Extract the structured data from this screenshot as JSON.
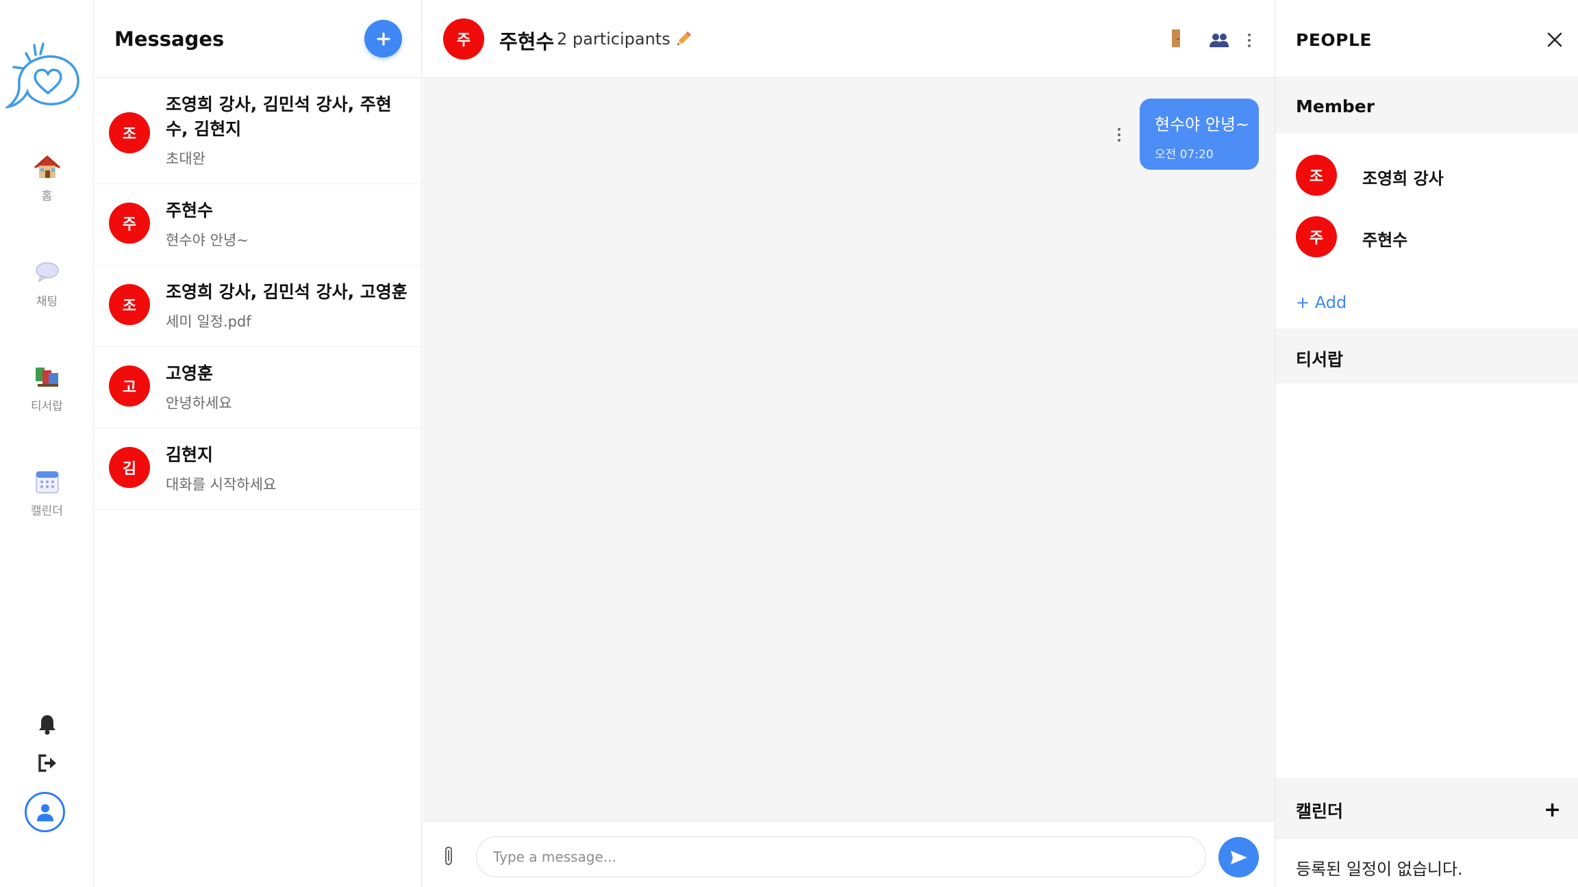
{
  "nav": {
    "items": [
      {
        "label": "홈",
        "icon": "home-icon"
      },
      {
        "label": "채팅",
        "icon": "chat-bubble-icon"
      },
      {
        "label": "티서랍",
        "icon": "books-icon"
      },
      {
        "label": "캘린더",
        "icon": "calendar-icon"
      }
    ],
    "bottom_icons": [
      "bell-icon",
      "logout-icon",
      "profile-icon"
    ]
  },
  "messages_panel": {
    "title": "Messages",
    "conversations": [
      {
        "avatar": "조",
        "name": "조영희 강사, 김민석 강사, 주현수, 김현지",
        "last": "초대완"
      },
      {
        "avatar": "주",
        "name": "주현수",
        "last": "현수야 안녕~"
      },
      {
        "avatar": "조",
        "name": "조영희 강사, 김민석 강사, 고영훈",
        "last": "세미 일정.pdf"
      },
      {
        "avatar": "고",
        "name": "고영훈",
        "last": "안녕하세요"
      },
      {
        "avatar": "김",
        "name": "김현지",
        "last": "대화를 시작하세요"
      }
    ]
  },
  "chat": {
    "avatar": "주",
    "name": "주현수",
    "participants": "2 participants",
    "messages": [
      {
        "text": "현수야 안녕~",
        "time": "오전 07:20",
        "mine": true
      }
    ],
    "input_placeholder": "Type a message..."
  },
  "people_panel": {
    "title": "PEOPLE",
    "member_section": "Member",
    "members": [
      {
        "avatar": "조",
        "name": "조영희 강사"
      },
      {
        "avatar": "주",
        "name": "주현수"
      }
    ],
    "add_label": "+ Add",
    "drawer_section": "티서랍",
    "calendar_section": "캘린더",
    "calendar_add": "+",
    "calendar_empty": "등록된 일정이 없습니다."
  },
  "colors": {
    "accent": "#3f87f5",
    "avatar": "#f20b0b",
    "bubble": "#4d8ef6"
  }
}
